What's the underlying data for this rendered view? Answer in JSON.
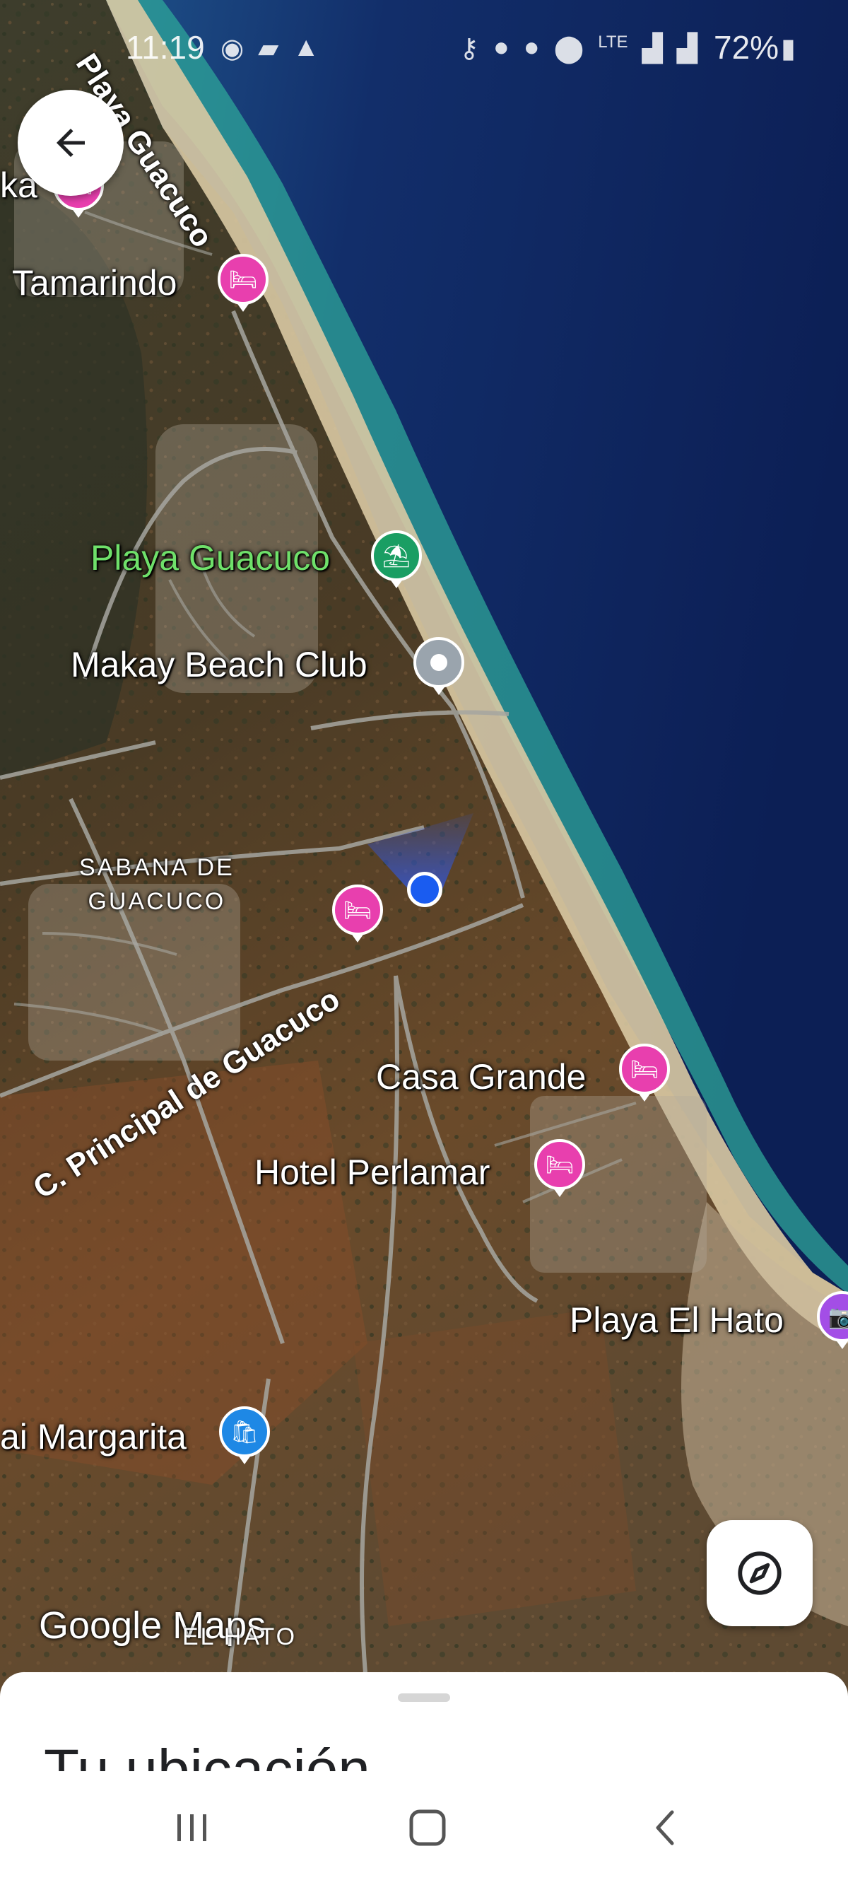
{
  "status_bar": {
    "time": "11:19",
    "battery": "72%",
    "icons_left": [
      "messenger-icon",
      "photo-icon",
      "alert-icon"
    ],
    "icons_right": [
      "key-icon",
      "badge-icon",
      "badge-icon",
      "location-icon",
      "lte-icon",
      "signal-icon",
      "signal-icon",
      "battery-icon"
    ]
  },
  "map": {
    "labels": {
      "playa_guacuco_road": "Playa Guacuco",
      "tamarindo": "Tamarindo",
      "ka": "ka",
      "playa_guacuco": "Playa Guacuco",
      "makay": "Makay Beach Club",
      "area_line1": "SABANA DE",
      "area_line2": "GUACUCO",
      "c_principal": "C. Principal de Guacuco",
      "casa_grande": "Casa Grande",
      "hotel_perlamar": "Hotel Perlamar",
      "playa_el_hato": "Playa El Hato",
      "margarita": "ai Margarita",
      "el_hato": "EL HATO"
    },
    "attribution": "Google Maps"
  },
  "bottom_sheet": {
    "title": "Tu ubicación"
  },
  "colors": {
    "sea_deep": "#0f2560",
    "sea_mid": "#1e4a8a",
    "surf": "#2fa79b",
    "sand": "#d8c8a2",
    "land": "#5a4a30",
    "hotel_pin": "#e83fae",
    "beach_pin": "#1a9e63",
    "location_dot": "#1a5cf0"
  }
}
